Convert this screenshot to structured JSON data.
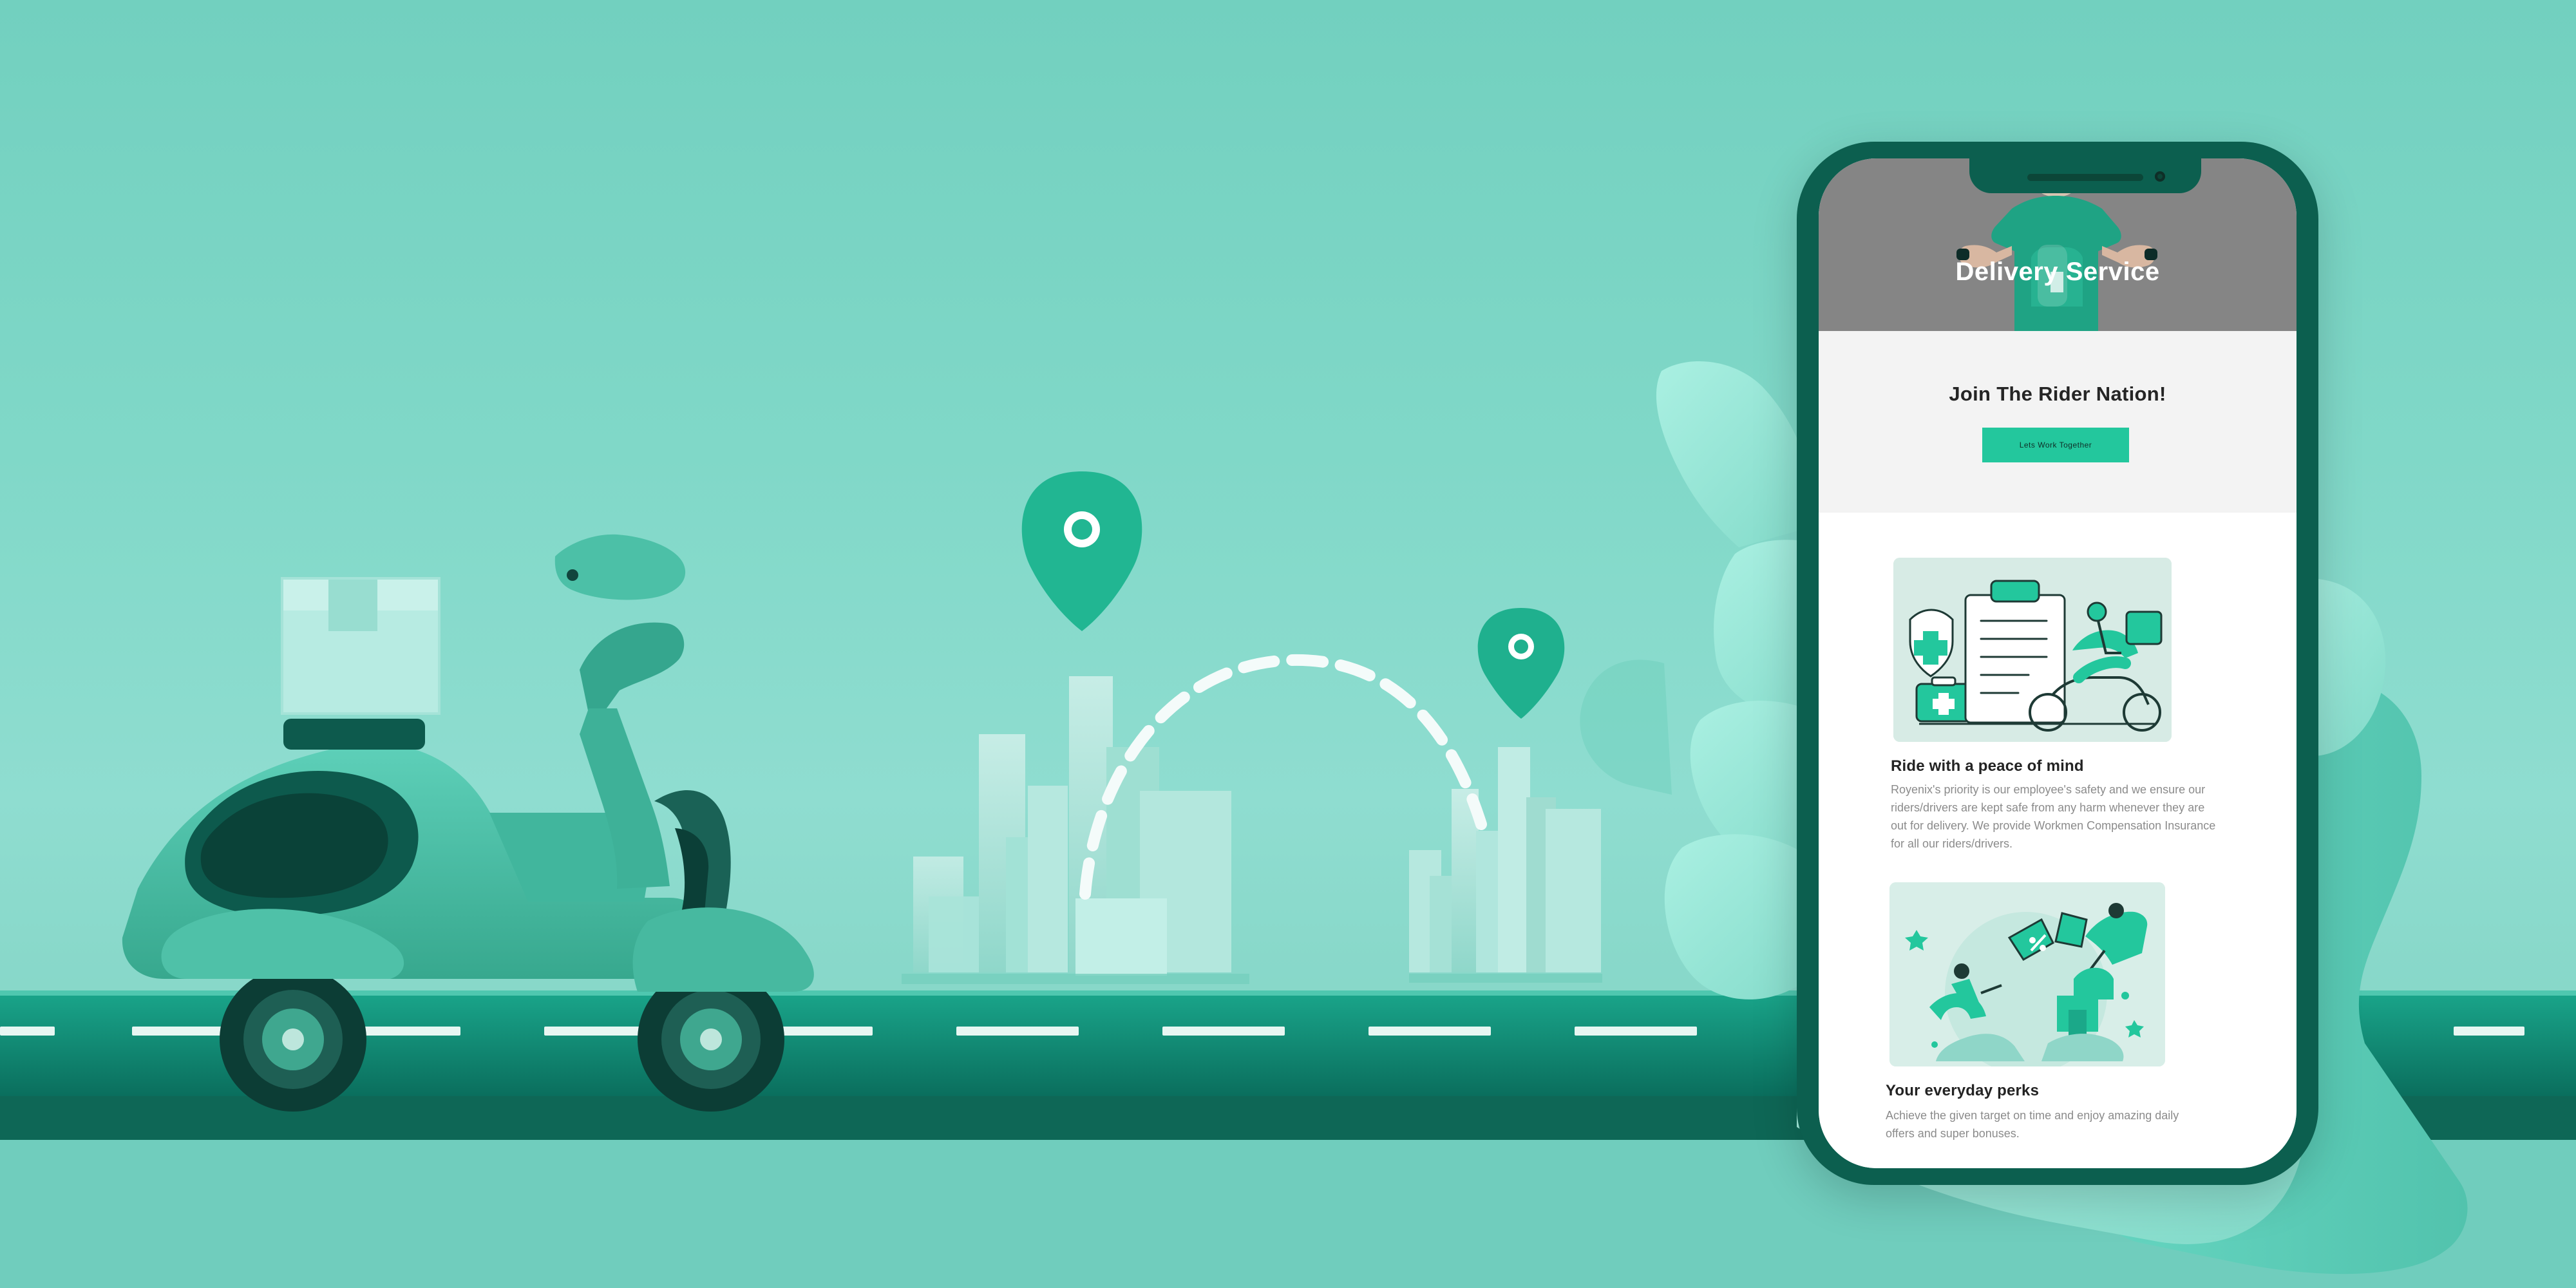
{
  "app": {
    "hero": {
      "title": "Delivery Service"
    },
    "join": {
      "title": "Join The Rider Nation!",
      "button_label": "Lets Work Together"
    },
    "cards": [
      {
        "title": "Ride with a peace of mind",
        "text": "Royenix's priority is our employee's safety and we ensure our riders/drivers are kept safe from any harm whenever they are out for delivery. We provide Workmen Compensation Insurance for all our riders/drivers."
      },
      {
        "title": "Your everyday perks",
        "text": "Achieve the given target on time and enjoy amazing daily offers and super bonuses."
      }
    ]
  },
  "colors": {
    "background": "#7ad5c3",
    "road": "#0c8f77",
    "road_dark": "#0a5b4c",
    "accent": "#23c79d",
    "hero_gray": "#8a8a8a",
    "phone_frame": "#0c5f4f"
  },
  "icons": {
    "map_pin": "location-pin-icon",
    "scooter": "scooter-icon",
    "box": "package-box-icon"
  }
}
